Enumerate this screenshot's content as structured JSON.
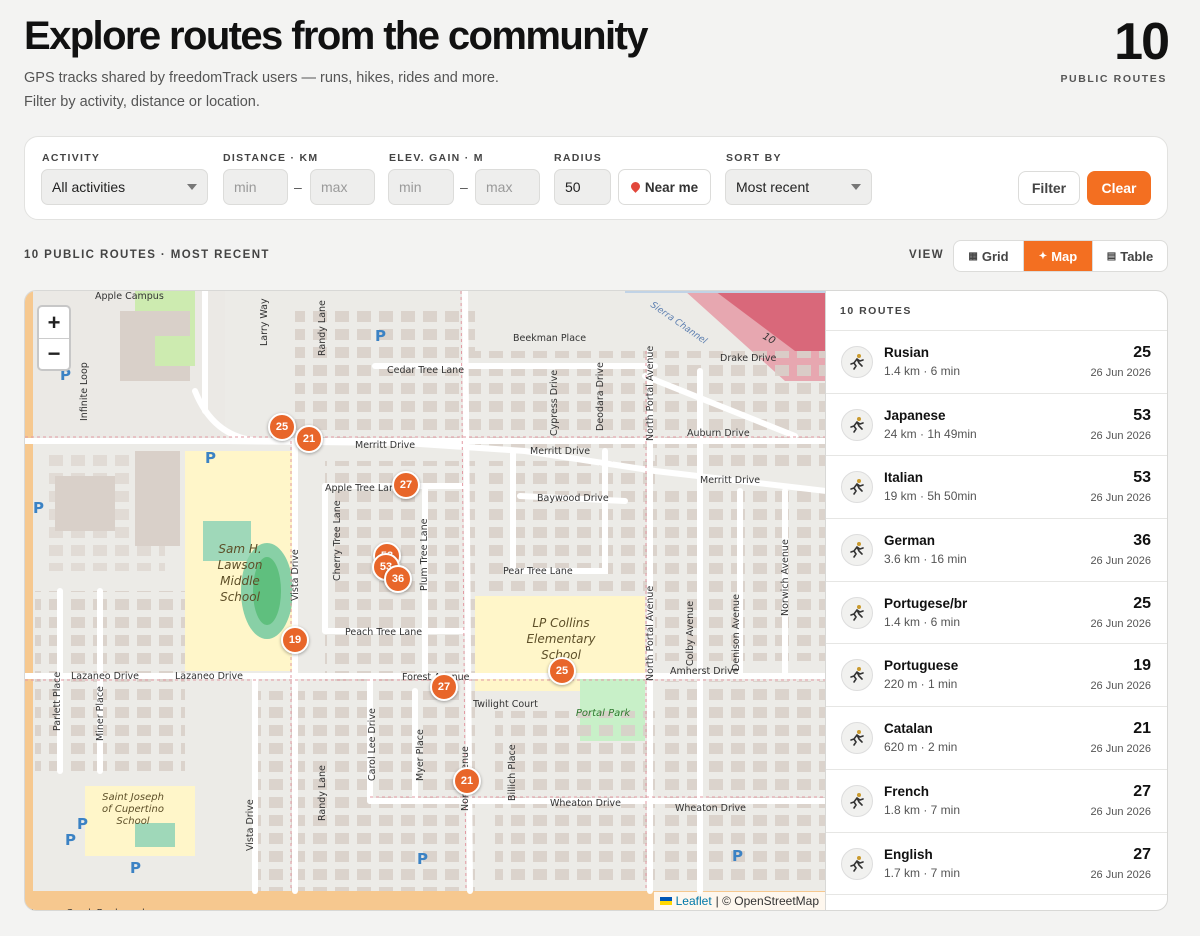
{
  "header": {
    "title": "Explore routes from the community",
    "subtitle": "GPS tracks shared by freedomTrack users — runs, hikes, rides and more. Filter by activity, distance or location.",
    "count": "10",
    "count_label": "PUBLIC ROUTES"
  },
  "filters": {
    "activity_label": "ACTIVITY",
    "activity_value": "All activities",
    "distance_label": "DISTANCE · KM",
    "distance_min": "min",
    "distance_max": "max",
    "elev_label": "ELEV. GAIN · M",
    "elev_min": "min",
    "elev_max": "max",
    "radius_label": "RADIUS",
    "radius_value": "50",
    "near_me": "Near me",
    "sort_label": "SORT BY",
    "sort_value": "Most recent",
    "filter_btn": "Filter",
    "clear_btn": "Clear"
  },
  "results": {
    "summary": "10 PUBLIC ROUTES · MOST RECENT",
    "view_label": "VIEW",
    "views": [
      "Grid",
      "Map",
      "Table"
    ],
    "active_view": "Map"
  },
  "map": {
    "zoom_in": "+",
    "zoom_out": "−",
    "attribution_link": "Leaflet",
    "attribution_text": "| © OpenStreetMap",
    "labels": [
      "Apple Campus",
      "Beekman Place",
      "Cedar Tree Lane",
      "Merritt Drive",
      "Apple Tree Lane",
      "Baywood Drive",
      "Pear Tree Lane",
      "Peach Tree Lane",
      "Lazaneo Drive",
      "Forest Avenue",
      "Twilight Court",
      "Wheaton Drive",
      "Amherst Drive",
      "Auburn Drive",
      "Drake Drive",
      "Sam H. Lawson Middle School",
      "LP Collins Elementary School",
      "Portal Park",
      "Saint Joseph of Cupertino School",
      "Stevens Creek Boulevard",
      "Larry Way",
      "Randy Lane",
      "Vista Drive",
      "Cherry Tree Lane",
      "Plum Tree Lane",
      "Carol Lee Drive",
      "Myer Place",
      "Cypress Drive",
      "Deodara Drive",
      "North Portal Avenue",
      "Colby Avenue",
      "Denison Avenue",
      "Norwich Avenue",
      "Miner Place",
      "Parlett Place",
      "Infinite Loop",
      "Billich Place"
    ],
    "markers": [
      "25",
      "21",
      "27",
      "53",
      "53",
      "36",
      "19",
      "27",
      "25",
      "21"
    ]
  },
  "routes": {
    "header": "10 ROUTES",
    "items": [
      {
        "name": "Rusian",
        "meta": "1.4 km · 6 min",
        "num": "25",
        "date": "26 Jun 2026"
      },
      {
        "name": "Japanese",
        "meta": "24 km · 1h 49min",
        "num": "53",
        "date": "26 Jun 2026"
      },
      {
        "name": "Italian",
        "meta": "19 km · 5h 50min",
        "num": "53",
        "date": "26 Jun 2026"
      },
      {
        "name": "German",
        "meta": "3.6 km · 16 min",
        "num": "36",
        "date": "26 Jun 2026"
      },
      {
        "name": "Portugese/br",
        "meta": "1.4 km · 6 min",
        "num": "25",
        "date": "26 Jun 2026"
      },
      {
        "name": "Portuguese",
        "meta": "220 m · 1 min",
        "num": "19",
        "date": "26 Jun 2026"
      },
      {
        "name": "Catalan",
        "meta": "620 m · 2 min",
        "num": "21",
        "date": "26 Jun 2026"
      },
      {
        "name": "French",
        "meta": "1.8 km · 7 min",
        "num": "27",
        "date": "26 Jun 2026"
      },
      {
        "name": "English",
        "meta": "1.7 km · 7 min",
        "num": "27",
        "date": "26 Jun 2026"
      }
    ]
  },
  "colors": {
    "accent": "#f36f21",
    "marker": "#e8662a",
    "map_bg": "#ecebe7",
    "school": "#fff6c9",
    "park": "#c8f0c8",
    "building": "#d9d0c9"
  }
}
